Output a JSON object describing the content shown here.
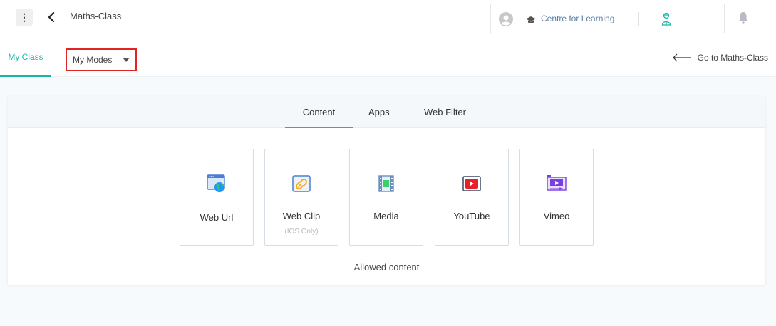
{
  "header": {
    "title": "Maths-Class",
    "org_name": "Centre for Learning"
  },
  "subnav": {
    "tab_myclass": "My Class",
    "tab_mymodes": "My Modes",
    "goto_label": "Go to Maths-Class"
  },
  "panel": {
    "tabs": [
      "Content",
      "Apps",
      "Web Filter"
    ],
    "active_tab": "Content",
    "cards": [
      {
        "label": "Web Url",
        "sub": ""
      },
      {
        "label": "Web Clip",
        "sub": "(IOS Only)"
      },
      {
        "label": "Media",
        "sub": ""
      },
      {
        "label": "YouTube",
        "sub": ""
      },
      {
        "label": "Vimeo",
        "sub": ""
      }
    ],
    "footer": "Allowed content"
  },
  "colors": {
    "accent": "#1bb4a8",
    "highlight_border": "#e02424",
    "youtube_red": "#e8202a",
    "vimeo_purple": "#7a3fe0"
  },
  "icons": [
    "kebab-menu-icon",
    "back-chevron-icon",
    "user-avatar-icon",
    "graduation-cap-icon",
    "teacher-icon",
    "bell-icon",
    "arrow-left-icon",
    "web-url-icon",
    "web-clip-icon",
    "media-icon",
    "youtube-icon",
    "vimeo-icon"
  ]
}
